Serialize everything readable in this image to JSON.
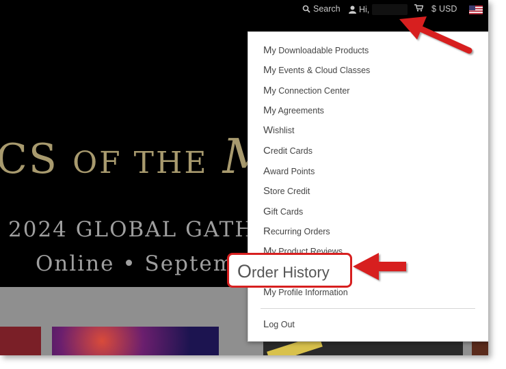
{
  "topbar": {
    "search_label": "Search",
    "greeting": "Hi,",
    "currency_symbol": "$",
    "currency_code": "USD",
    "icons": [
      "search-icon",
      "user-icon",
      "cart-icon",
      "us-flag-icon"
    ]
  },
  "hero": {
    "title_part1": "CS",
    "title_part2": "OF THE",
    "title_part3": "M",
    "line2": "2024 GLOBAL GATH",
    "line3": "Online • Septemb"
  },
  "menu": {
    "items": [
      {
        "first": "M",
        "rest": "y Downloadable Products"
      },
      {
        "first": "M",
        "rest": "y Events & Cloud Classes"
      },
      {
        "first": "M",
        "rest": "y Connection Center"
      },
      {
        "first": "M",
        "rest": "y Agreements"
      },
      {
        "first": "W",
        "rest": "ishlist"
      },
      {
        "first": "C",
        "rest": "redit Cards"
      },
      {
        "first": "A",
        "rest": "ward Points"
      },
      {
        "first": "S",
        "rest": "tore Credit"
      },
      {
        "first": "G",
        "rest": "ift Cards"
      },
      {
        "first": "R",
        "rest": "ecurring Orders"
      },
      {
        "first": "M",
        "rest": "y Product Reviews"
      },
      {
        "first": "M",
        "rest": "y Profile Information"
      }
    ],
    "logout": {
      "first": "L",
      "rest": "og Out"
    }
  },
  "highlight": {
    "first": "O",
    "rest": "rder History"
  },
  "colors": {
    "annotation_red": "#d71f1f",
    "hero_gold": "#a89a6e",
    "hero_gray": "#9f9f9f"
  }
}
